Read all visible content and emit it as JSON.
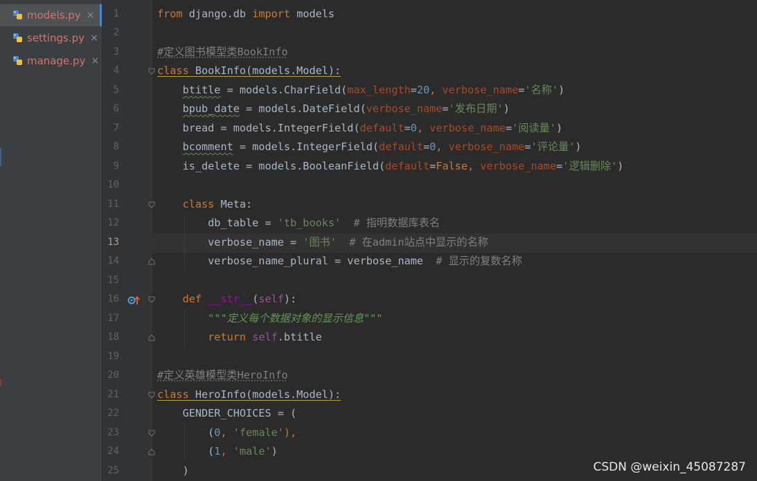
{
  "tabs": [
    {
      "label": "models.py",
      "active": true,
      "icon": "python-file-icon"
    },
    {
      "label": "settings.py",
      "active": false,
      "icon": "python-file-icon"
    },
    {
      "label": "manage.py",
      "active": false,
      "icon": "python-file-icon"
    }
  ],
  "tab_close_glyph": "×",
  "current_line": 13,
  "line_numbers": [
    "1",
    "2",
    "3",
    "4",
    "5",
    "6",
    "7",
    "8",
    "9",
    "10",
    "11",
    "12",
    "13",
    "14",
    "15",
    "16",
    "17",
    "18",
    "19",
    "20",
    "21",
    "22",
    "23",
    "24",
    "25"
  ],
  "code": {
    "l1": [
      "from",
      " django.db ",
      "import",
      " models"
    ],
    "l3": "#定义图书模型类BookInfo",
    "l4": [
      "class",
      " BookInfo(models.Model):"
    ],
    "l5": [
      "    ",
      "btitle",
      " = models.CharField(",
      "max_length",
      "=",
      "20",
      ", ",
      "verbose_name",
      "=",
      "'名称'",
      ")"
    ],
    "l6": [
      "    ",
      "bpub_date",
      " = models.DateField(",
      "verbose_name",
      "=",
      "'发布日期'",
      ")"
    ],
    "l7": [
      "    bread = models.IntegerField(",
      "default",
      "=",
      "0",
      ", ",
      "verbose_name",
      "=",
      "'阅读量'",
      ")"
    ],
    "l8": [
      "    ",
      "bcomment",
      " = models.IntegerField(",
      "default",
      "=",
      "0",
      ", ",
      "verbose_name",
      "=",
      "'评论量'",
      ")"
    ],
    "l9": [
      "    is_delete = models.BooleanField(",
      "default",
      "=",
      "False",
      ", ",
      "verbose_name",
      "=",
      "'逻辑删除'",
      ")"
    ],
    "l11": [
      "    ",
      "class",
      " Meta:"
    ],
    "l12": [
      "        db_table = ",
      "'tb_books'",
      "  # 指明数据库表名"
    ],
    "l13": [
      "        verbose_name = ",
      "'图书'",
      "  # 在admin站点中显示的名称"
    ],
    "l14": [
      "        verbose_name_plural = verbose_name  ",
      "# 显示的复数名称"
    ],
    "l16": [
      "    ",
      "def",
      " ",
      "__str__",
      "(",
      "self",
      "):"
    ],
    "l17": [
      "        ",
      "\"\"\"定义每个数据对象的显示信息\"\"\""
    ],
    "l18": [
      "        ",
      "return",
      " ",
      "self",
      ".btitle"
    ],
    "l20": "#定义英雄模型类HeroInfo",
    "l21": [
      "class",
      " HeroInfo(models.Model):"
    ],
    "l22": "    GENDER_CHOICES = (",
    "l23": [
      "        (",
      "0",
      ", ",
      "'female'",
      "),"
    ],
    "l24": [
      "        (",
      "1",
      ", ",
      "'male'",
      ")"
    ],
    "l25": "    )"
  },
  "watermark": "CSDN @weixin_45087287",
  "colors": {
    "keyword": "#cc7832",
    "string": "#6a8759",
    "number": "#6897bb",
    "comment": "#808080",
    "kwarg": "#aa4926",
    "self": "#94558d",
    "docstring": "#629755",
    "text": "#a9b7c6",
    "tab_text": "#d4736b"
  }
}
